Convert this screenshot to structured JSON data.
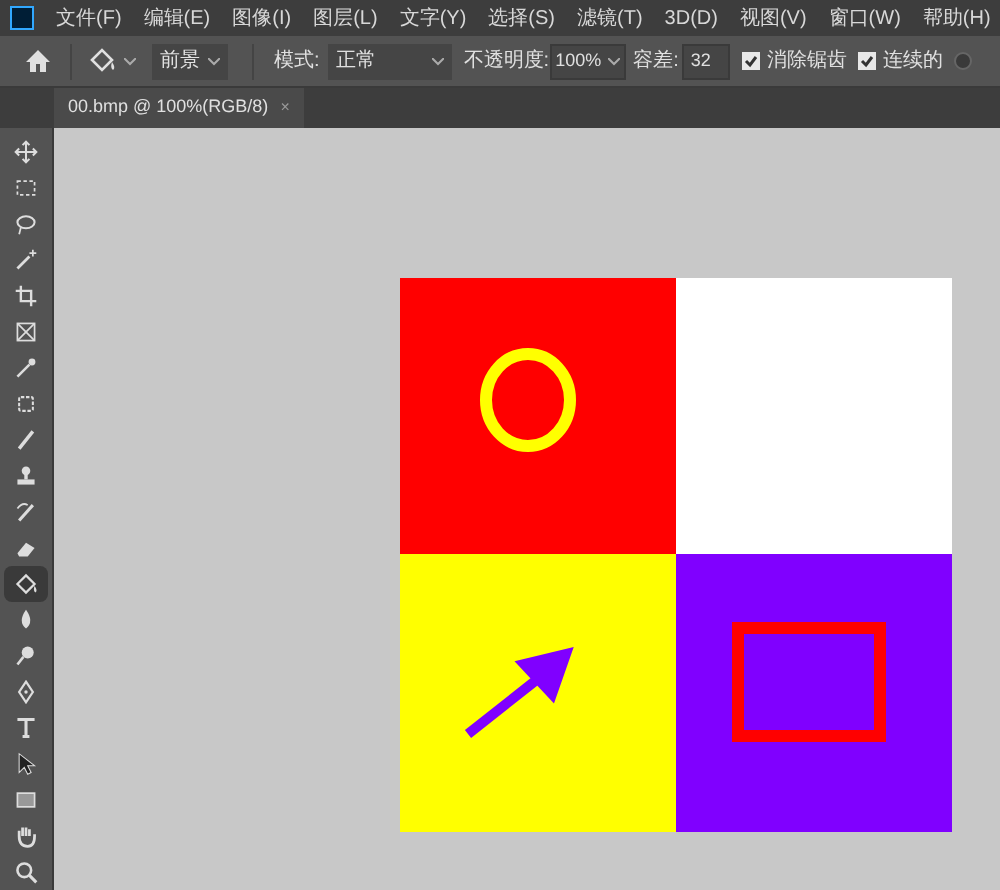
{
  "menu_bar": {
    "items": [
      "文件(F)",
      "编辑(E)",
      "图像(I)",
      "图层(L)",
      "文字(Y)",
      "选择(S)",
      "滤镜(T)",
      "3D(D)",
      "视图(V)",
      "窗口(W)",
      "帮助(H)"
    ]
  },
  "options_bar": {
    "fill_source": "前景",
    "mode_label": "模式:",
    "mode": "正常",
    "opacity_label": "不透明度:",
    "opacity": "100%",
    "tolerance_label": "容差:",
    "tolerance": "32",
    "checkboxes": [
      {
        "label": "消除锯齿",
        "checked": true
      },
      {
        "label": "连续的",
        "checked": true
      },
      {
        "checked": false
      }
    ]
  },
  "document_tab": {
    "title": "00.bmp @ 100%(RGB/8)",
    "close": "×"
  },
  "tools": [
    {
      "selected": false
    },
    {
      "selected": false
    },
    {
      "selected": false
    },
    {
      "selected": false
    },
    {
      "selected": false
    },
    {
      "selected": false
    },
    {
      "selected": false
    },
    {
      "selected": false
    },
    {
      "selected": false
    },
    {
      "selected": false
    },
    {
      "selected": false
    },
    {
      "selected": false
    },
    {
      "selected": true
    },
    {
      "selected": false
    },
    {
      "selected": false
    },
    {
      "selected": false
    },
    {
      "selected": false
    },
    {
      "selected": false
    },
    {
      "selected": false
    },
    {
      "selected": false
    },
    {
      "selected": false
    }
  ]
}
